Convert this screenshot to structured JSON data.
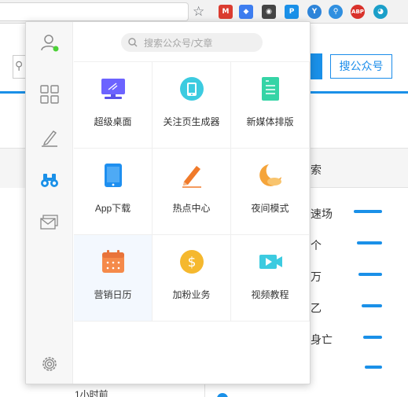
{
  "browser": {
    "extensions": [
      {
        "name": "gmail-extension",
        "glyph": "M",
        "color": "#db3c30"
      },
      {
        "name": "layers-extension",
        "glyph": "◆",
        "color": "#3d7df0"
      },
      {
        "name": "color-wheel-extension",
        "glyph": "◉",
        "color": "#444444"
      },
      {
        "name": "wechat-helper-extension",
        "glyph": "P",
        "color": "#1a90e8"
      },
      {
        "name": "vuejs-extension",
        "glyph": "Y",
        "color": "#2d84d9"
      },
      {
        "name": "key-extension",
        "glyph": "⚲",
        "color": "#2f8fe0"
      },
      {
        "name": "adblock-plus-extension",
        "glyph": "ABP",
        "color": "#d9322b"
      },
      {
        "name": "globe-extension",
        "glyph": "◕",
        "color": "#1b9fc9"
      }
    ]
  },
  "background": {
    "search_button": "搜公众号",
    "right_header": "索",
    "right_items": [
      "速场",
      "个",
      "万",
      "乙",
      "身亡",
      ""
    ],
    "bar_widths": [
      36,
      32,
      30,
      26,
      24,
      22
    ],
    "time_label": "1小时前"
  },
  "popup": {
    "search_placeholder": "搜索公众号/文章",
    "sidebar": [
      {
        "name": "user-icon",
        "active": false
      },
      {
        "name": "apps-grid-icon",
        "active": false
      },
      {
        "name": "pen-icon",
        "active": false
      },
      {
        "name": "binoculars-icon",
        "active": true
      },
      {
        "name": "mail-icon",
        "active": false
      }
    ],
    "tools": [
      {
        "label": "超级桌面",
        "icon": "monitor-icon",
        "color": "#6c63ff"
      },
      {
        "label": "关注页生成器",
        "icon": "phone-circle-icon",
        "color": "#3ccbe0"
      },
      {
        "label": "新媒体排版",
        "icon": "document-icon",
        "color": "#35d4a6"
      },
      {
        "label": "App下载",
        "icon": "tablet-icon",
        "color": "#1e8ff0"
      },
      {
        "label": "热点中心",
        "icon": "pencil-icon",
        "color": "#f07a2a"
      },
      {
        "label": "夜间模式",
        "icon": "moon-icon",
        "color": "#f5a43a"
      },
      {
        "label": "营销日历",
        "icon": "calendar-icon",
        "color": "#f58a4a"
      },
      {
        "label": "加粉业务",
        "icon": "dollar-coin-icon",
        "color": "#f5b82e"
      },
      {
        "label": "视频教程",
        "icon": "video-icon",
        "color": "#3ccbe0"
      }
    ],
    "selected_index": 6
  }
}
